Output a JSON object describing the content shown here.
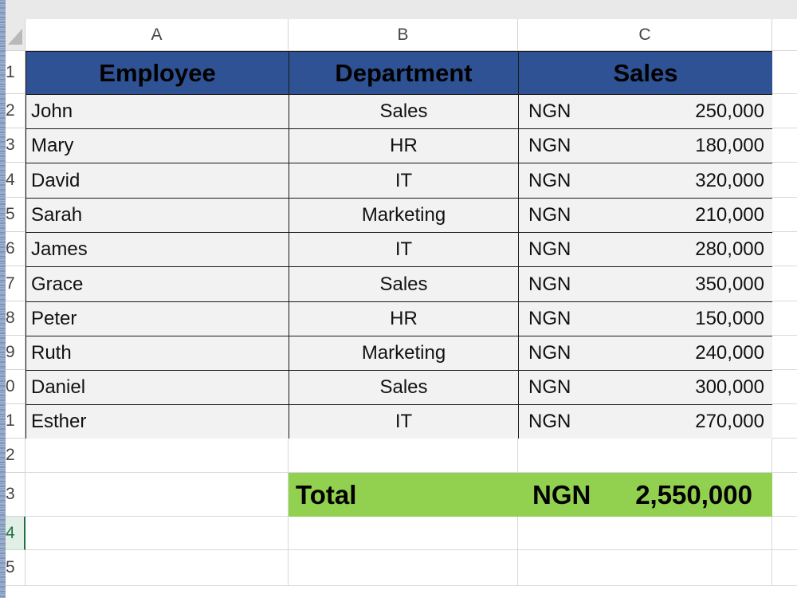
{
  "columns": [
    "A",
    "B",
    "C"
  ],
  "rows": [
    "1",
    "2",
    "3",
    "4",
    "5",
    "6",
    "7",
    "8",
    "9",
    "0",
    "1",
    "2",
    "3",
    "4",
    "5"
  ],
  "table": {
    "headers": [
      "Employee",
      "Department",
      "Sales"
    ],
    "currency": "NGN",
    "records": [
      {
        "employee": "John",
        "department": "Sales",
        "amount": "250,000"
      },
      {
        "employee": "Mary",
        "department": "HR",
        "amount": "180,000"
      },
      {
        "employee": "David",
        "department": "IT",
        "amount": "320,000"
      },
      {
        "employee": "Sarah",
        "department": "Marketing",
        "amount": "210,000"
      },
      {
        "employee": "James",
        "department": "IT",
        "amount": "280,000"
      },
      {
        "employee": "Grace",
        "department": "Sales",
        "amount": "350,000"
      },
      {
        "employee": "Peter",
        "department": "HR",
        "amount": "150,000"
      },
      {
        "employee": "Ruth",
        "department": "Marketing",
        "amount": "240,000"
      },
      {
        "employee": "Daniel",
        "department": "Sales",
        "amount": "300,000"
      },
      {
        "employee": "Esther",
        "department": "IT",
        "amount": "270,000"
      }
    ]
  },
  "total": {
    "label": "Total",
    "currency": "NGN",
    "amount": "2,550,000"
  },
  "colors": {
    "header_fill": "#2e5293",
    "total_fill": "#92d050",
    "cell_fill": "#f2f2f2",
    "active_row": "#1e7145"
  }
}
